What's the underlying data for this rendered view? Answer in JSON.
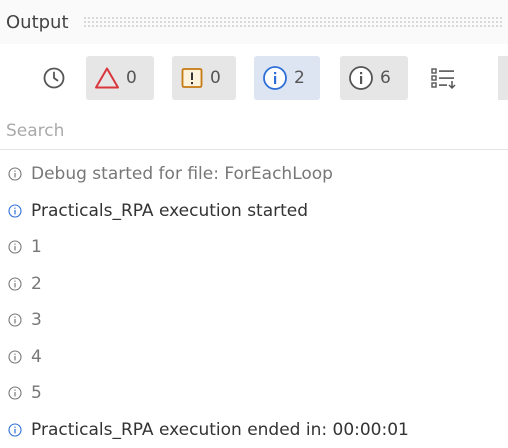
{
  "panel": {
    "title": "Output"
  },
  "toolbar": {
    "errors_count": "0",
    "warnings_count": "0",
    "info_count": "2",
    "trace_count": "6"
  },
  "search": {
    "placeholder": "Search",
    "value": ""
  },
  "log": [
    {
      "text": "Debug started for file: ForEachLoop",
      "kind": "trace"
    },
    {
      "text": "Practicals_RPA execution started",
      "kind": "info"
    },
    {
      "text": "1",
      "kind": "trace"
    },
    {
      "text": "2",
      "kind": "trace"
    },
    {
      "text": "3",
      "kind": "trace"
    },
    {
      "text": "4",
      "kind": "trace"
    },
    {
      "text": "5",
      "kind": "trace"
    },
    {
      "text": "Practicals_RPA execution ended in: 00:00:01",
      "kind": "info"
    }
  ],
  "icons": {
    "clock": "clock-icon",
    "error": "error-triangle-icon",
    "warning": "warning-square-icon",
    "info": "info-circle-icon",
    "trace": "trace-circle-icon",
    "filter": "filter-list-icon"
  },
  "colors": {
    "error": "#d9363e",
    "warning": "#c57a12",
    "info": "#2d6fd6",
    "trace": "#777777",
    "selected_bg": "#dde5f3",
    "shaded_bg": "#e6e6e6"
  }
}
